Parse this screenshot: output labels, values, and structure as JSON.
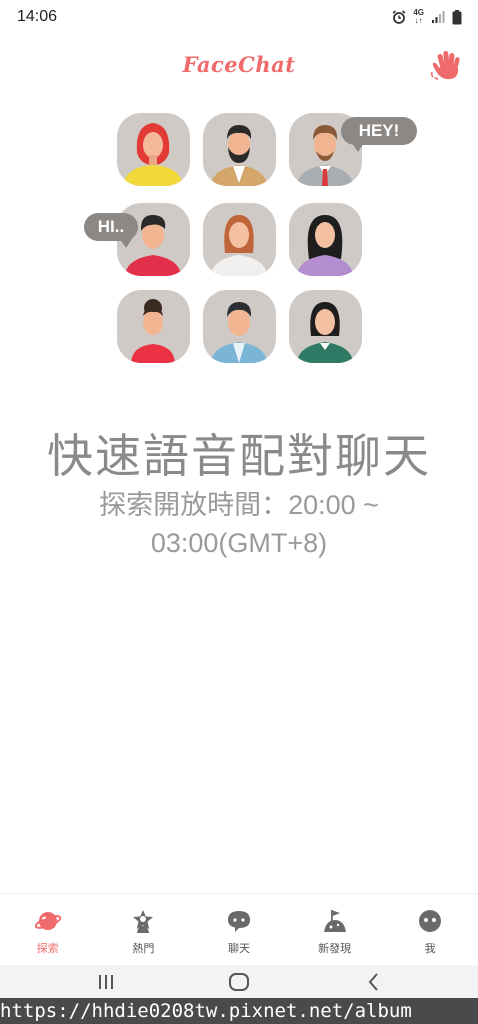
{
  "status_bar": {
    "time": "14:06",
    "network": "4G",
    "icons": [
      "alarm-icon",
      "network-4g-icon",
      "signal-icon",
      "battery-icon"
    ]
  },
  "header": {
    "logo": "FaceChat",
    "wave_icon": "wave-hand-icon",
    "accent_color": "#ef6b6b"
  },
  "avatars": {
    "speech_bubbles": [
      "HEY!",
      "HI.."
    ]
  },
  "main": {
    "headline": "快速語音配對聊天",
    "subline": "探索開放時間：20:00 ~ 03:00(GMT+8)"
  },
  "bottom_nav": {
    "items": [
      {
        "label": "探索",
        "icon": "planet-icon",
        "active": true
      },
      {
        "label": "熱門",
        "icon": "star-person-icon",
        "active": false
      },
      {
        "label": "聊天",
        "icon": "chat-bubble-icon",
        "active": false
      },
      {
        "label": "新發現",
        "icon": "discover-flag-icon",
        "active": false
      },
      {
        "label": "我",
        "icon": "profile-face-icon",
        "active": false
      }
    ]
  },
  "system_nav": {
    "buttons": [
      "recent-apps-icon",
      "home-icon",
      "back-icon"
    ]
  },
  "watermark": {
    "text": "https://hhdie0208tw.pixnet.net/album"
  }
}
